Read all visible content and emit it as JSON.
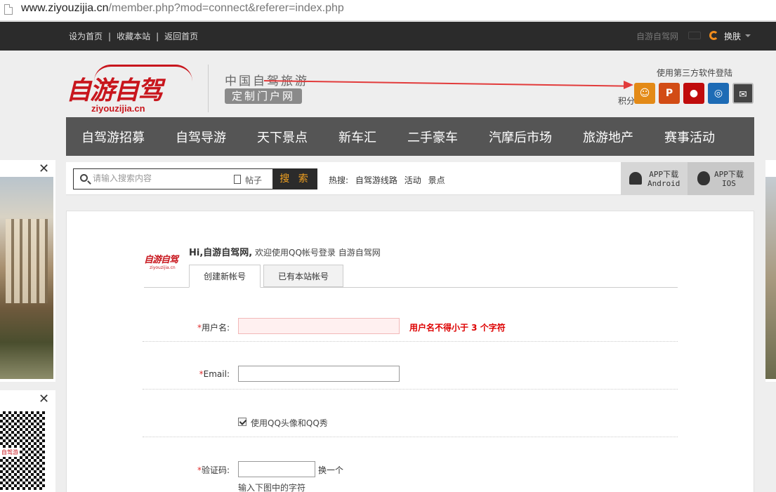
{
  "browser": {
    "url_host": "www.ziyouzijia.cn",
    "url_path": "/member.php?mod=connect&referer=index.php"
  },
  "topbar": {
    "links": [
      "设为首页",
      "收藏本站",
      "返回首页"
    ],
    "site_name": "自游自驾网",
    "skin_label": "换肤"
  },
  "header": {
    "logo_text": "自游自驾",
    "logo_sub": "ziyouzijia.cn",
    "slogan_line1": "中国自驾旅游",
    "slogan_line2": "定制门户网",
    "third_party_label": "使用第三方软件登陆",
    "score_label": "积分"
  },
  "social_icons": [
    "weibo-icon",
    "tencent-weibo-icon",
    "qq-icon",
    "wechat-icon",
    "mail-icon"
  ],
  "nav": {
    "items": [
      "自驾游招募",
      "自驾导游",
      "天下景点",
      "新车汇",
      "二手豪车",
      "汽摩后市场",
      "旅游地产",
      "赛事活动"
    ]
  },
  "search": {
    "placeholder": "请输入搜索内容",
    "scope": "帖子",
    "button": "搜 索",
    "hot_label": "热搜:",
    "hot_items": [
      "自驾游线路",
      "活动",
      "景点"
    ],
    "app_android_line1": "APP下载",
    "app_android_line2": "Android",
    "app_ios_line1": "APP下载",
    "app_ios_line2": "IOS"
  },
  "ads": {
    "close": "✕",
    "qr_tag": "自驾游"
  },
  "login": {
    "mini_logo": "自游自驾",
    "mini_logo_sub": "ziyouzijia.cn",
    "greeting_hi": "Hi,自游自驾网,",
    "greeting_rest": " 欢迎使用QQ帐号登录 自游自驾网",
    "tabs": [
      "创建新帐号",
      "已有本站帐号"
    ],
    "username_label": "用户名:",
    "username_value": "",
    "username_error": "用户名不得小于 3 个字符",
    "email_label": "Email:",
    "email_value": "",
    "use_qq_avatar_label": "使用QQ头像和QQ秀",
    "use_qq_avatar_checked": true,
    "captcha_label": "验证码:",
    "captcha_value": "",
    "captcha_refresh": "换一个",
    "captcha_hint": "输入下图中的字符",
    "required_mark": "*"
  },
  "colors": {
    "brand_red": "#c8161d",
    "topbar_bg": "#2b2b2b",
    "nav_bg": "#555555",
    "search_btn_text": "#f0a020",
    "error_red": "#dd0000"
  }
}
